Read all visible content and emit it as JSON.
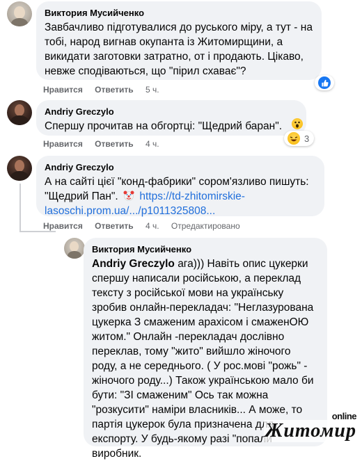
{
  "comments": [
    {
      "author": "Виктория Мусийченко",
      "text": "Завбачливо підготувалися до руського міру, а тут - на тобі, народ вигнав окупанта із Житомирщини, а викидати заготовки затратно, от і продають. Цікаво, невже сподіваються, що \"пipил схаває\"?",
      "like": "Нравится",
      "reply": "Ответить",
      "time": "5 ч."
    },
    {
      "author": "Andriy Greczylo",
      "text": "Спершу прочитав на обгортці: \"Щедрий баран\".",
      "like": "Нравится",
      "reply": "Ответить",
      "time": "4 ч.",
      "reaction_count": "3"
    },
    {
      "author": "Andriy Greczylo",
      "text_before_link": "А на сайті цієї \"конд-фабрики\" сором'язливо пишуть: \"Щедрий Пан\".",
      "link": "https://td-zhitomirskie-lasoschi.prom.ua/.../p1011325808...",
      "like": "Нравится",
      "reply": "Ответить",
      "time": "4 ч.",
      "edited": "Отредактировано"
    },
    {
      "author": "Виктория Мусийченко",
      "mention": "Andriy Greczylo",
      "text": "ага))) Навіть опис цукерки спершу написали російською, а переклад тексту з російської мови на українську зробив онлайн-перекладач: \"Неглазурована цукерка З смаженим арахісом і смаженОЮ житом.\" Онлайн -перекладач дослівно переклав, тому \"жито\" вийшло жіночого роду, а не середнього. ( У рос.мові \"рожь\" - жіночого роду...) Також українською мало би бути: \"ЗІ смаженим\" Ось так можна \"розкусити\" наміри власників... А може, то партія цукерок була призначена для експорту. У будь-якому разі \"попали\" виробник."
    }
  ],
  "watermark": {
    "online": "online",
    "main": "Житомир"
  },
  "colors": {
    "bubble": "#f0f2f5",
    "link": "#216fdb",
    "meta": "#65676b",
    "like_blue": "#1877f2"
  },
  "icons": [
    "like-reaction-icon",
    "haha-reaction-icon",
    "wow-reaction-icon",
    "clown-emoji-icon"
  ]
}
